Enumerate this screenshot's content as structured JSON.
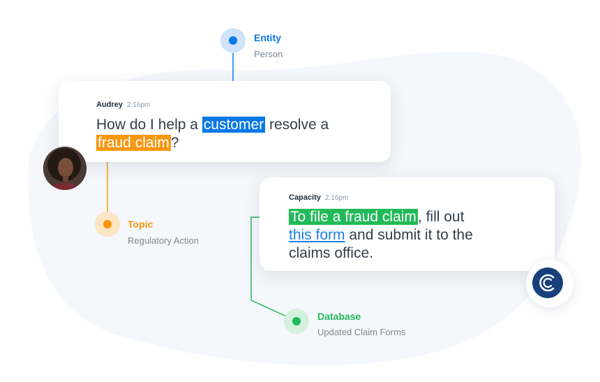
{
  "entity": {
    "title": "Entity",
    "subtitle": "Person"
  },
  "user_message": {
    "author": "Audrey",
    "time": "2:16pm",
    "text_before": "How do I help a ",
    "entity_highlight": "customer",
    "text_middle": " resolve a",
    "topic_highlight": "fraud claim",
    "text_after": "?"
  },
  "topic": {
    "title": "Topic",
    "subtitle": "Regulatory Action"
  },
  "bot_message": {
    "author": "Capacity",
    "time": "2:16pm",
    "database_highlight": "To file a fraud claim",
    "text_after_highlight": ", fill out",
    "link_text": "this form",
    "text_after_link": " and submit it to the",
    "text_last_line": "claims office."
  },
  "database": {
    "title": "Database",
    "subtitle": "Updated Claim Forms"
  },
  "colors": {
    "entity": "#0a78e6",
    "topic": "#f7960f",
    "database": "#22ba58",
    "brand": "#17407c",
    "background_blob": "#f4f7fb"
  },
  "icons": {
    "avatar": "user-avatar-photo",
    "brand_logo": "capacity-logo-icon"
  }
}
